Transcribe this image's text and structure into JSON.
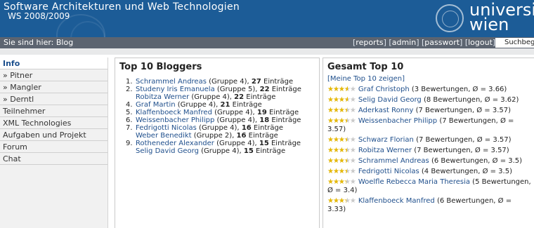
{
  "header": {
    "title": "Software Architekturen und Web Technologien",
    "subtitle": "WS 2008/2009",
    "logo_line1": "universität",
    "logo_line2": "wien"
  },
  "crumb": "Sie sind hier: Blog",
  "toplinks": [
    "reports",
    "admin",
    "passwort",
    "logout"
  ],
  "search_placeholder": "Suchbegriff",
  "sidebar": [
    {
      "label": "Info",
      "active": true
    },
    {
      "label": "» Pitner",
      "active": false
    },
    {
      "label": "» Mangler",
      "active": false
    },
    {
      "label": "» Derntl",
      "active": false
    },
    {
      "label": "Teilnehmer",
      "active": false
    },
    {
      "label": "XML Technologies",
      "active": false
    },
    {
      "label": "Aufgaben und Projekt",
      "active": false
    },
    {
      "label": "Forum",
      "active": false
    },
    {
      "label": "Chat",
      "active": false
    }
  ],
  "bloggers": {
    "title": "Top 10 Bloggers",
    "items": [
      {
        "rank": "1.",
        "name": "Schrammel Andreas",
        "group": "(Gruppe 4),",
        "count": "27",
        "suffix": "Einträge"
      },
      {
        "rank": "2.",
        "name": "Studeny Iris Emanuela",
        "group": "(Gruppe 5),",
        "count": "22",
        "suffix": "Einträge"
      },
      {
        "rank": "",
        "name": "Robitza Werner",
        "group": "(Gruppe 4),",
        "count": "22",
        "suffix": "Einträge"
      },
      {
        "rank": "4.",
        "name": "Graf Martin",
        "group": "(Gruppe 4),",
        "count": "21",
        "suffix": "Einträge"
      },
      {
        "rank": "5.",
        "name": "Klaffenboeck Manfred",
        "group": "(Gruppe 4),",
        "count": "19",
        "suffix": "Einträge"
      },
      {
        "rank": "6.",
        "name": "Weissenbacher Philipp",
        "group": "(Gruppe 4),",
        "count": "18",
        "suffix": "Einträge"
      },
      {
        "rank": "7.",
        "name": "Fedrigotti Nicolas",
        "group": "(Gruppe 4),",
        "count": "16",
        "suffix": "Einträge"
      },
      {
        "rank": "",
        "name": "Weber Benedikt",
        "group": "(Gruppe 2),",
        "count": "16",
        "suffix": "Einträge"
      },
      {
        "rank": "9.",
        "name": "Rotheneder Alexander",
        "group": "(Gruppe 4),",
        "count": "15",
        "suffix": "Einträge"
      },
      {
        "rank": "",
        "name": "Selig David Georg",
        "group": "(Gruppe 4),",
        "count": "15",
        "suffix": "Einträge"
      }
    ]
  },
  "gesamt": {
    "title": "Gesamt Top 10",
    "link": "[Meine Top 10 zeigen]",
    "items": [
      {
        "rating": 3.66,
        "name": "Graf Christoph",
        "detail": "(3 Bewertungen, Ø = 3.66)"
      },
      {
        "rating": 3.62,
        "name": "Selig David Georg",
        "detail": "(8 Bewertungen, Ø = 3.62)"
      },
      {
        "rating": 3.57,
        "name": "Aderkast Ronny",
        "detail": "(7 Bewertungen, Ø = 3.57)"
      },
      {
        "rating": 3.57,
        "name": "Weissenbacher Philipp",
        "detail": "(7 Bewertungen, Ø = 3.57)"
      },
      {
        "rating": 3.57,
        "name": "Schwarz Florian",
        "detail": "(7 Bewertungen, Ø = 3.57)"
      },
      {
        "rating": 3.57,
        "name": "Robitza Werner",
        "detail": "(7 Bewertungen, Ø = 3.57)"
      },
      {
        "rating": 3.5,
        "name": "Schrammel Andreas",
        "detail": "(6 Bewertungen, Ø = 3.5)"
      },
      {
        "rating": 3.5,
        "name": "Fedrigotti Nicolas",
        "detail": "(4 Bewertungen, Ø = 3.5)"
      },
      {
        "rating": 3.4,
        "name": "Woelfle Rebecca Maria Theresia",
        "detail": "(5 Bewertungen, Ø = 3.4)"
      },
      {
        "rating": 3.33,
        "name": "Klaffenboeck Manfred",
        "detail": "(6 Bewertungen, Ø = 3.33)"
      }
    ]
  }
}
